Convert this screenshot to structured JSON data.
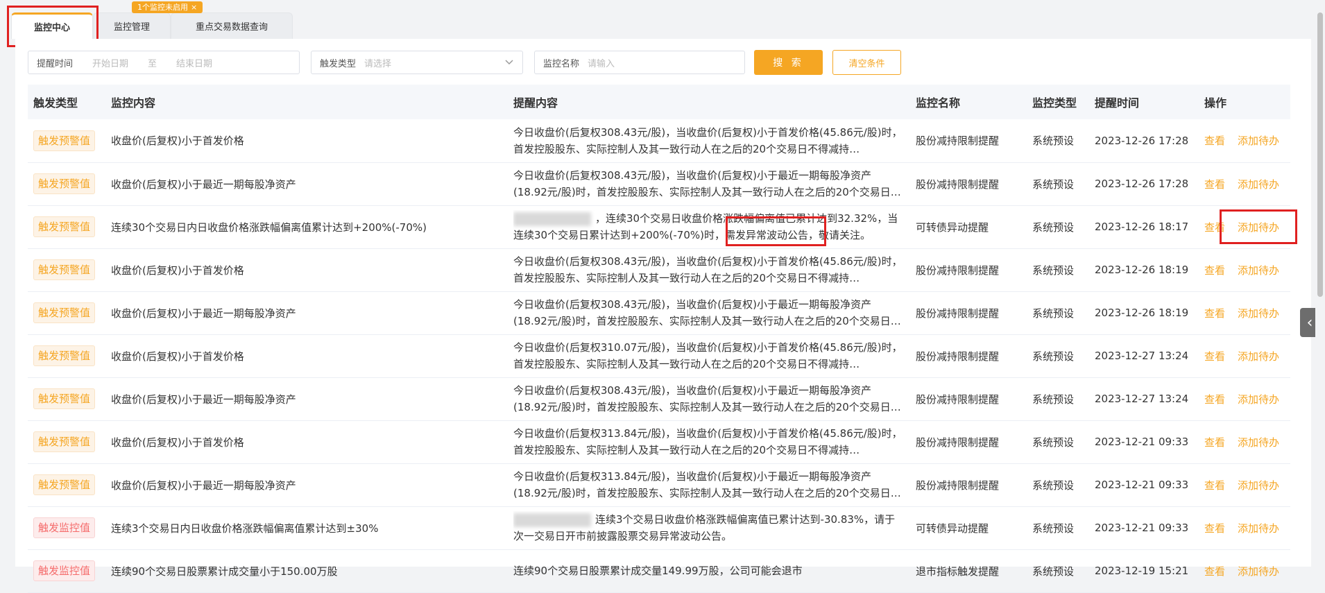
{
  "tabs": [
    {
      "label": "监控中心",
      "active": true
    },
    {
      "label": "监控管理",
      "active": false
    },
    {
      "label": "重点交易数据查询",
      "active": false
    }
  ],
  "tab_badge": {
    "text": "1个监控未启用",
    "close": "×"
  },
  "filters": {
    "time_label": "提醒时间",
    "start_placeholder": "开始日期",
    "to": "至",
    "end_placeholder": "结束日期",
    "trigger_label": "触发类型",
    "trigger_placeholder": "请选择",
    "name_label": "监控名称",
    "name_placeholder": "请输入",
    "search_button": "搜 索",
    "clear_button": "清空条件"
  },
  "table": {
    "headers": [
      "触发类型",
      "监控内容",
      "提醒内容",
      "监控名称",
      "监控类型",
      "提醒时间",
      "操作"
    ],
    "actions": {
      "view": "查看",
      "todo": "添加待办"
    },
    "rows": [
      {
        "type": "触发预警值",
        "level": "warn",
        "content": "收盘价(后复权)小于首发价格",
        "remind": "今日收盘价(后复权308.43元/股)，当收盘价(后复权)小于首发价格(45.86元/股)时，首发控股股东、实际控制人及其一致行动人在之后的20个交易日不得减持…",
        "name": "股份减持限制提醒",
        "mtype": "系统预设",
        "time": "2023-12-26 17:28"
      },
      {
        "type": "触发预警值",
        "level": "warn",
        "content": "收盘价(后复权)小于最近一期每股净资产",
        "remind": "今日收盘价(后复权308.43元/股)，当收盘价(后复权)小于最近一期每股净资产(18.92元/股)时，首发控股股东、实际控制人及其一致行动人在之后的20个交易日不…",
        "name": "股份减持限制提醒",
        "mtype": "系统预设",
        "time": "2023-12-26 17:28"
      },
      {
        "type": "触发预警值",
        "level": "warn",
        "content": "连续30个交易日内日收盘价格涨跌幅偏离值累计达到+200%(-70%)",
        "blur": true,
        "remind": "，连续30个交易日收盘价格涨跌幅偏离值已累计达到32.32%，当连续30个交易日累计达到+200%(-70%)时，需发异常波动公告，敬请关注。",
        "name": "可转债异动提醒",
        "mtype": "系统预设",
        "time": "2023-12-26 18:17"
      },
      {
        "type": "触发预警值",
        "level": "warn",
        "content": "收盘价(后复权)小于首发价格",
        "remind": "今日收盘价(后复权308.43元/股)，当收盘价(后复权)小于首发价格(45.86元/股)时，首发控股股东、实际控制人及其一致行动人在之后的20个交易日不得减持…",
        "name": "股份减持限制提醒",
        "mtype": "系统预设",
        "time": "2023-12-26 18:19"
      },
      {
        "type": "触发预警值",
        "level": "warn",
        "content": "收盘价(后复权)小于最近一期每股净资产",
        "remind": "今日收盘价(后复权308.43元/股)，当收盘价(后复权)小于最近一期每股净资产(18.92元/股)时，首发控股股东、实际控制人及其一致行动人在之后的20个交易日不…",
        "name": "股份减持限制提醒",
        "mtype": "系统预设",
        "time": "2023-12-26 18:19"
      },
      {
        "type": "触发预警值",
        "level": "warn",
        "content": "收盘价(后复权)小于首发价格",
        "remind": "今日收盘价(后复权310.07元/股)，当收盘价(后复权)小于首发价格(45.86元/股)时，首发控股股东、实际控制人及其一致行动人在之后的20个交易日不得减持…",
        "name": "股份减持限制提醒",
        "mtype": "系统预设",
        "time": "2023-12-27 13:24"
      },
      {
        "type": "触发预警值",
        "level": "warn",
        "content": "收盘价(后复权)小于最近一期每股净资产",
        "remind": "今日收盘价(后复权308.43元/股)，当收盘价(后复权)小于最近一期每股净资产(18.92元/股)时，首发控股股东、实际控制人及其一致行动人在之后的20个交易日不…",
        "name": "股份减持限制提醒",
        "mtype": "系统预设",
        "time": "2023-12-27 13:24"
      },
      {
        "type": "触发预警值",
        "level": "warn",
        "content": "收盘价(后复权)小于首发价格",
        "remind": "今日收盘价(后复权313.84元/股)，当收盘价(后复权)小于首发价格(45.86元/股)时，首发控股股东、实际控制人及其一致行动人在之后的20个交易日不得减持…",
        "name": "股份减持限制提醒",
        "mtype": "系统预设",
        "time": "2023-12-21 09:33"
      },
      {
        "type": "触发预警值",
        "level": "warn",
        "content": "收盘价(后复权)小于最近一期每股净资产",
        "remind": "今日收盘价(后复权313.84元/股)，当收盘价(后复权)小于最近一期每股净资产(18.92元/股)时，首发控股股东、实际控制人及其一致行动人在之后的20个交易日不…",
        "name": "股份减持限制提醒",
        "mtype": "系统预设",
        "time": "2023-12-21 09:33"
      },
      {
        "type": "触发监控值",
        "level": "alert",
        "content": "连续3个交易日内日收盘价格涨跌幅偏离值累计达到±30%",
        "blur": true,
        "remind": "连续3个交易日收盘价格涨跌幅偏离值已累计达到-30.83%，请于次一交易日开市前披露股票交易异常波动公告。",
        "name": "可转债异动提醒",
        "mtype": "系统预设",
        "time": "2023-12-21 09:33"
      },
      {
        "type": "触发监控值",
        "level": "alert",
        "content": "连续90个交易日股票累计成交量小于150.00万股",
        "remind": "连续90个交易日股票累计成交量149.99万股，公司可能会退市",
        "name": "退市指标触发提醒",
        "mtype": "系统预设",
        "time": "2023-12-19 15:21"
      }
    ]
  },
  "side_toggle": "‹"
}
